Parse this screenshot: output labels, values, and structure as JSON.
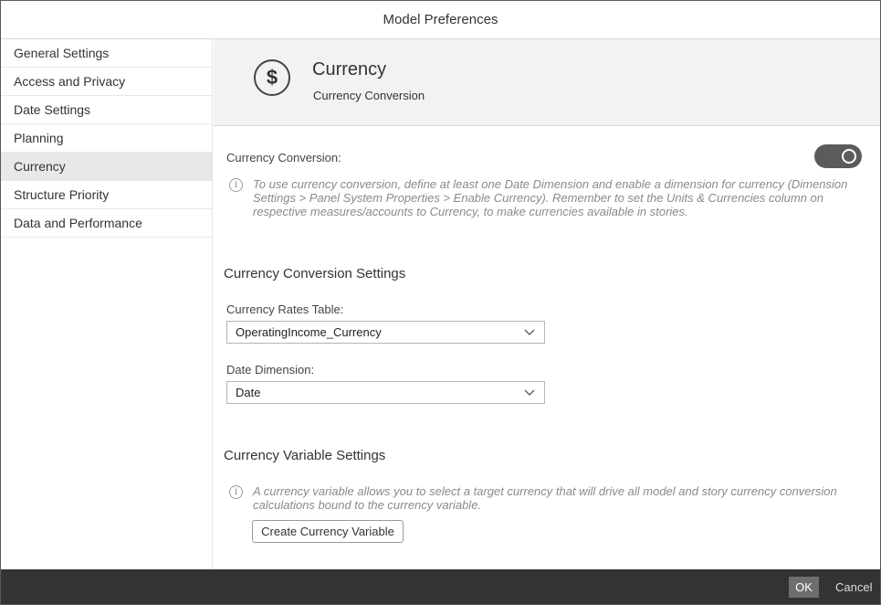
{
  "dialog": {
    "title": "Model Preferences"
  },
  "sidebar": {
    "items": [
      {
        "label": "General Settings"
      },
      {
        "label": "Access and Privacy"
      },
      {
        "label": "Date Settings"
      },
      {
        "label": "Planning"
      },
      {
        "label": "Currency",
        "active": true
      },
      {
        "label": "Structure Priority"
      },
      {
        "label": "Data and Performance"
      }
    ]
  },
  "header": {
    "icon": "dollar-circle-icon",
    "icon_glyph": "$",
    "title": "Currency",
    "subtitle": "Currency Conversion"
  },
  "currency_conversion": {
    "label": "Currency Conversion:",
    "toggle_on": true,
    "info_glyph": "i",
    "info_line1": "To use currency conversion, define at least one Date Dimension and enable a dimension for currency (Dimension",
    "info_line2": "Settings > Panel System Properties > Enable Currency). Remember to set the Units & Currencies column on",
    "info_line3": "respective measures/accounts to Currency, to make currencies available in stories."
  },
  "conversion_settings": {
    "heading": "Currency Conversion Settings",
    "rates_table_label": "Currency Rates Table:",
    "rates_table_value": "OperatingIncome_Currency",
    "date_dimension_label": "Date Dimension:",
    "date_dimension_value": "Date"
  },
  "variable_settings": {
    "heading": "Currency Variable Settings",
    "info_glyph": "i",
    "info_line1": "A currency variable allows you to select a target currency that will drive all model and story currency conversion",
    "info_line2": "calculations bound to the currency variable.",
    "create_button": "Create Currency Variable"
  },
  "footer": {
    "ok_label": "OK",
    "cancel_label": "Cancel"
  },
  "colors": {
    "footer_bg": "#333333",
    "toggle_bg": "#5b5b5b",
    "header_band_bg": "#f2f2f2",
    "active_nav_bg": "#e8e8e8"
  }
}
